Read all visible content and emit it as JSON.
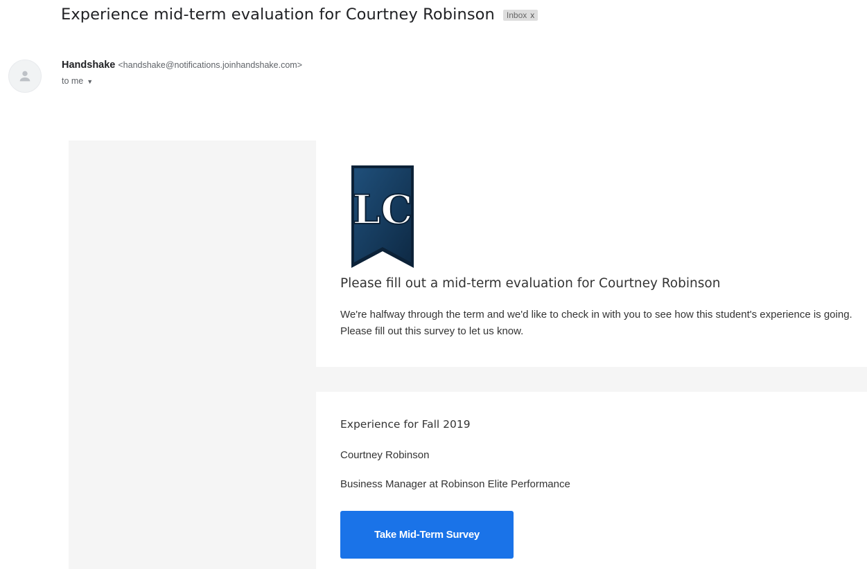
{
  "subject": "Experience mid-term evaluation for Courtney Robinson",
  "label_chip": {
    "text": "Inbox",
    "close": "x"
  },
  "sender": {
    "name": "Handshake",
    "email": "<handshake@notifications.joinhandshake.com>",
    "recipient": "to me",
    "avatar_icon": "person-icon"
  },
  "email": {
    "logo_letters": "LC",
    "heading": "Please fill out a mid-term evaluation for Courtney Robinson",
    "intro": "We're halfway through the term and we'd like to check in with you to see how this student's experience is going. Please fill out this survey to let us know.",
    "experience_title": "Experience for Fall 2019",
    "student_name": "Courtney Robinson",
    "position": "Business Manager at Robinson Elite Performance",
    "cta_label": "Take Mid-Term Survey"
  },
  "colors": {
    "accent_button": "#1a73e8",
    "logo_navy": "#163d5e",
    "panel_bg": "#f5f5f5"
  }
}
